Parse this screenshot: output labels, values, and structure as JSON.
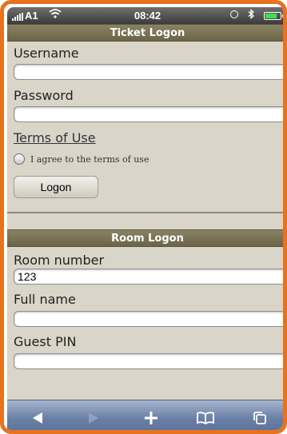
{
  "status_bar": {
    "carrier": "A1",
    "time": "08:42",
    "battery_level": 0.85,
    "icons": [
      "signal-bars-icon",
      "wifi-icon",
      "alarm-icon",
      "bluetooth-icon",
      "battery-icon"
    ]
  },
  "ticket_logon": {
    "header": "Ticket Logon",
    "username_label": "Username",
    "username_value": "",
    "password_label": "Password",
    "password_value": "",
    "terms_link": "Terms of Use",
    "agree_label": "I agree to the terms of use",
    "agree_checked": false,
    "logon_button": "Logon"
  },
  "room_logon": {
    "header": "Room Logon",
    "room_number_label": "Room number",
    "room_number_value": "123",
    "full_name_label": "Full name",
    "full_name_value": "",
    "guest_pin_label": "Guest PIN",
    "guest_pin_value": ""
  },
  "toolbar": {
    "icons": [
      "back-arrow-icon",
      "forward-arrow-icon",
      "add-icon",
      "bookmarks-icon",
      "pages-icon"
    ]
  },
  "colors": {
    "frame": "#e7731f",
    "header_bg": "#7a7356",
    "page_bg": "#d9d5c9",
    "toolbar": "#6b80a6"
  }
}
